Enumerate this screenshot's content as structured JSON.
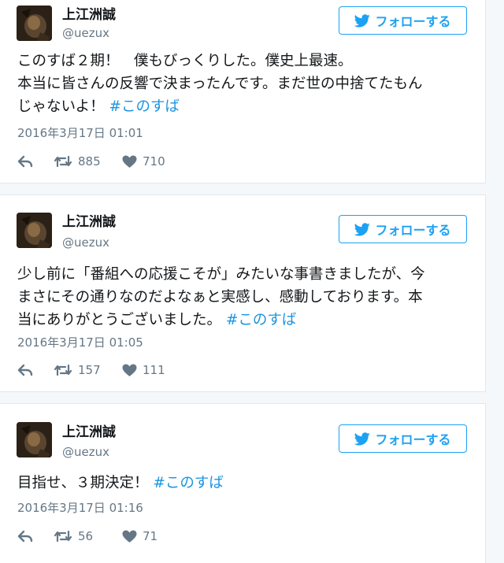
{
  "colors": {
    "accent": "#1da1f2",
    "hashtag": "#1b95e0",
    "muted": "#657786",
    "text": "#14171a"
  },
  "icons": {
    "follow": "twitter-bird-icon",
    "reply": "reply-arrow-icon",
    "retweet": "retweet-icon",
    "like": "heart-icon"
  },
  "tweets": [
    {
      "name": "上江洲誠",
      "handle": "@uezux",
      "follow_label": "フォローする",
      "text": "このすば２期！　僕もびっくりした。僕史上最速。\n本当に皆さんの反響で決まったんです。まだ世の中捨てたもん\nじゃないよ！ ",
      "hashtag": "#このすば",
      "timestamp": "2016年3月17日 01:01",
      "retweets": "885",
      "likes": "710"
    },
    {
      "name": "上江洲誠",
      "handle": "@uezux",
      "follow_label": "フォローする",
      "text": "少し前に「番組への応援こそが」みたいな事書きましたが、今\nまさにその通りなのだよなぁと実感し、感動しております。本\n当にありがとうございました。 ",
      "hashtag": "#このすば",
      "timestamp": "2016年3月17日 01:05",
      "retweets": "157",
      "likes": "111"
    },
    {
      "name": "上江洲誠",
      "handle": "@uezux",
      "follow_label": "フォローする",
      "text": "目指せ、３期決定！ ",
      "hashtag": "#このすば",
      "timestamp": "2016年3月17日 01:16",
      "retweets": "56",
      "likes": "71"
    }
  ]
}
